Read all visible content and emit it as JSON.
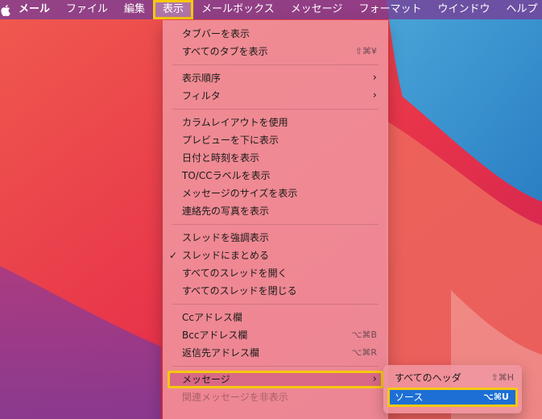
{
  "menubar": {
    "items": [
      "メール",
      "ファイル",
      "編集",
      "表示",
      "メールボックス",
      "メッセージ",
      "フォーマット",
      "ウインドウ",
      "ヘルプ"
    ]
  },
  "view_menu": {
    "tab_bar": "タブバーを表示",
    "all_tabs": "すべてのタブを表示",
    "all_tabs_shortcut": "⇧⌘¥",
    "sort": "表示順序",
    "filter": "フィルタ",
    "column_layout": "カラムレイアウトを使用",
    "preview_below": "プレビューを下に表示",
    "date_time": "日付と時刻を表示",
    "tocc": "TO/CCラベルを表示",
    "msg_size": "メッセージのサイズを表示",
    "contact_photos": "連絡先の写真を表示",
    "highlight_threads": "スレッドを強調表示",
    "organize_threads": "スレッドにまとめる",
    "check": "✓",
    "open_threads": "すべてのスレッドを開く",
    "close_threads": "すべてのスレッドを閉じる",
    "cc_field": "Ccアドレス欄",
    "bcc_field": "Bccアドレス欄",
    "bcc_shortcut": "⌥⌘B",
    "reply_to_field": "返信先アドレス欄",
    "reply_to_shortcut": "⌥⌘R",
    "message": "メッセージ",
    "hide_related": "関連メッセージを非表示"
  },
  "submenu": {
    "all_headers": "すべてのヘッダ",
    "all_headers_shortcut": "⇧⌘H",
    "source": "ソース",
    "source_shortcut": "⌥⌘U"
  },
  "colors": {
    "highlight_outline": "#f6c80e",
    "selection": "#1d6fd6"
  }
}
